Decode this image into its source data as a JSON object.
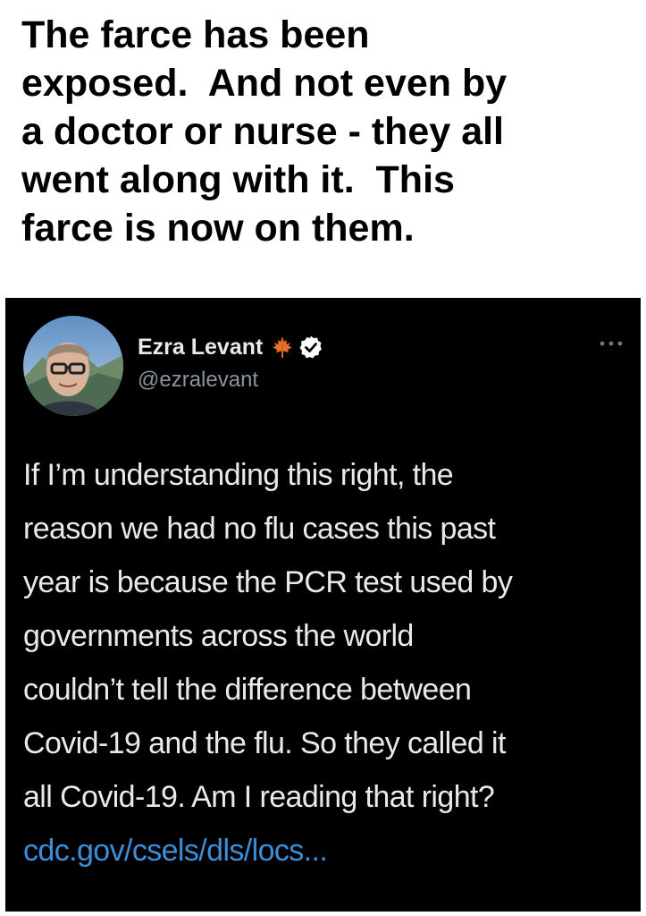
{
  "caption": {
    "lines": [
      "The farce has been",
      "exposed.  And not even by",
      "a doctor or nurse - they all",
      "went along with it.  This",
      "farce is now on them."
    ]
  },
  "tweet": {
    "author": {
      "display_name": "Ezra Levant",
      "handle": "@ezralevant",
      "badges": [
        "maple-leaf-icon",
        "verified-check-icon"
      ]
    },
    "menu_icon": "more-options-icon",
    "body_lines": [
      "If I’m understanding this right, the",
      "reason we had no flu cases this past",
      "year is because the PCR test used by",
      "governments across the world",
      "couldn’t tell the difference between",
      "Covid-19 and the flu. So they called it",
      "all Covid-19. Am I reading that right?"
    ],
    "link_text": "cdc.gov/csels/dls/locs...",
    "colors": {
      "background": "#000000",
      "text": "#e7e9ea",
      "handle": "#8b949e",
      "link": "#3a8fd8",
      "maple_leaf": "#e8702a"
    }
  }
}
